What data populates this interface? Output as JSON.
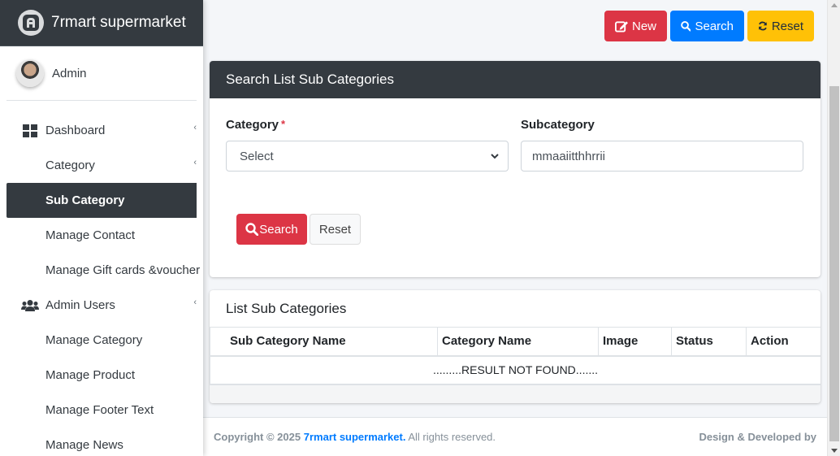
{
  "brand": {
    "name": "7rmart supermarket"
  },
  "user": {
    "name": "Admin"
  },
  "sidebar": {
    "items": [
      {
        "label": "Dashboard",
        "icon": "dashboard-grid-icon",
        "arrow": "‹"
      },
      {
        "label": "Category",
        "arrow": "‹"
      },
      {
        "label": "Sub Category",
        "active": true
      },
      {
        "label": "Manage Contact"
      },
      {
        "label": "Manage Gift cards &voucher"
      },
      {
        "label": "Admin Users",
        "icon": "users-icon",
        "arrow": "‹"
      },
      {
        "label": "Manage Category"
      },
      {
        "label": "Manage Product"
      },
      {
        "label": "Manage Footer Text"
      },
      {
        "label": "Manage News"
      }
    ]
  },
  "toolbar": {
    "new_label": "New",
    "search_label": "Search",
    "reset_label": "Reset"
  },
  "search_card": {
    "title": "Search List Sub Categories",
    "category_label": "Category",
    "required_mark": "*",
    "category_value": "Select",
    "subcategory_label": "Subcategory",
    "subcategory_value": "mmaaiitthhrrii",
    "search_button": "Search",
    "reset_button": "Reset"
  },
  "list_card": {
    "title": "List Sub Categories",
    "columns": [
      "Sub Category Name",
      "Category Name",
      "Image",
      "Status",
      "Action"
    ],
    "empty_message": ".........RESULT NOT FOUND......."
  },
  "footer": {
    "copyright_prefix": "Copyright © 2025",
    "company": "7rmart supermarket.",
    "rights": "All rights reserved.",
    "credit": "Design & Developed by"
  },
  "colors": {
    "dark": "#343a40",
    "danger": "#dc3545",
    "primary": "#007bff",
    "warning": "#ffc107"
  }
}
